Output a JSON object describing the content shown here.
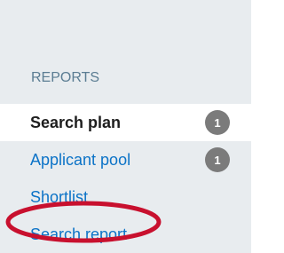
{
  "reports_nav": {
    "section_label": "REPORTS",
    "items": [
      {
        "label": "Search plan",
        "count": "1",
        "active": true
      },
      {
        "label": "Applicant pool",
        "count": "1",
        "active": false
      },
      {
        "label": "Shortlist",
        "count": null,
        "active": false
      },
      {
        "label": "Search report",
        "count": null,
        "active": false,
        "highlighted": true
      }
    ]
  },
  "colors": {
    "sidebar_background": "#e8ecef",
    "active_row_background": "#ffffff",
    "link_color": "#0c73c7",
    "active_text_color": "#1e1e1e",
    "section_header_color": "#5b7d93",
    "badge_color": "#7b7b7b",
    "highlight_ring_color": "#c8102e"
  }
}
